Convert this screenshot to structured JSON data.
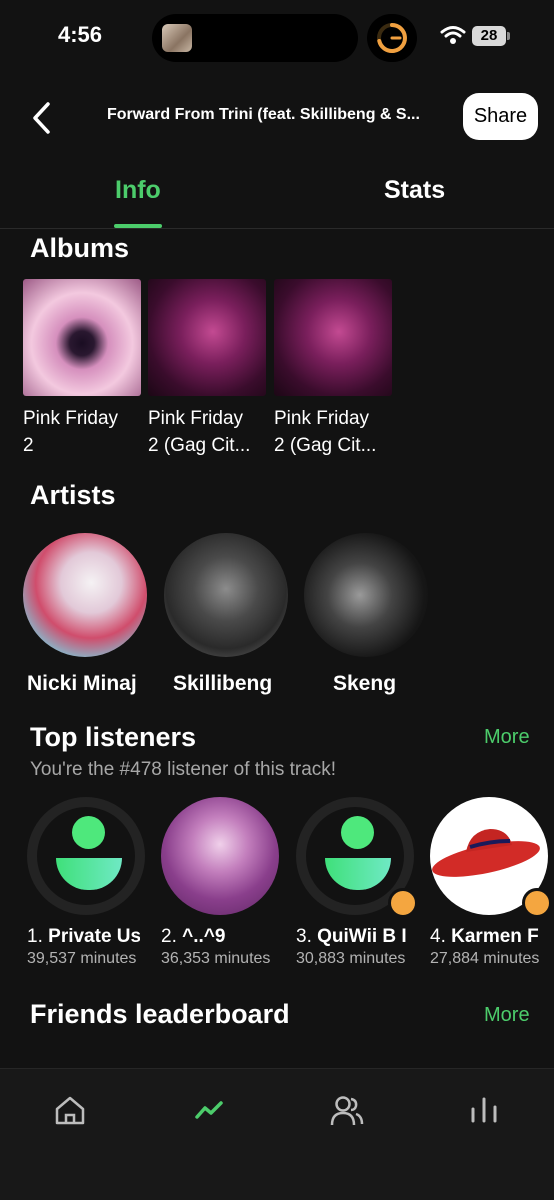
{
  "status_bar": {
    "time": "4:56",
    "battery": "28"
  },
  "header": {
    "title": "Forward From Trini (feat. Skillibeng & S...",
    "share_label": "Share"
  },
  "tabs": [
    {
      "label": "Info",
      "active": true
    },
    {
      "label": "Stats",
      "active": false
    }
  ],
  "albums": {
    "heading": "Albums",
    "items": [
      {
        "line1": "Pink Friday",
        "line2": "2"
      },
      {
        "line1": "Pink Friday",
        "line2": "2 (Gag Cit..."
      },
      {
        "line1": "Pink Friday",
        "line2": "2 (Gag Cit..."
      }
    ]
  },
  "artists": {
    "heading": "Artists",
    "items": [
      {
        "name": "Nicki Minaj"
      },
      {
        "name": "Skillibeng"
      },
      {
        "name": "Skeng"
      }
    ]
  },
  "top_listeners": {
    "heading": "Top listeners",
    "more_label": "More",
    "subtitle": "You're the #478 listener of this track!",
    "items": [
      {
        "rank": "1.",
        "name": "Private Us",
        "minutes": "39,537 minutes"
      },
      {
        "rank": "2.",
        "name": "^..^9",
        "minutes": "36,353 minutes"
      },
      {
        "rank": "3.",
        "name": "QuiWii B I",
        "minutes": "30,883 minutes"
      },
      {
        "rank": "4.",
        "name": "Karmen F",
        "minutes": "27,884 minutes"
      }
    ]
  },
  "friends_leaderboard": {
    "heading": "Friends leaderboard",
    "more_label": "More"
  },
  "bottom_nav": [
    {
      "icon": "home-icon",
      "active": false
    },
    {
      "icon": "trending-icon",
      "active": true
    },
    {
      "icon": "friends-icon",
      "active": false
    },
    {
      "icon": "charts-icon",
      "active": false
    }
  ],
  "colors": {
    "accent": "#4ccc6b",
    "background": "#121212",
    "badge": "#f4a640"
  }
}
